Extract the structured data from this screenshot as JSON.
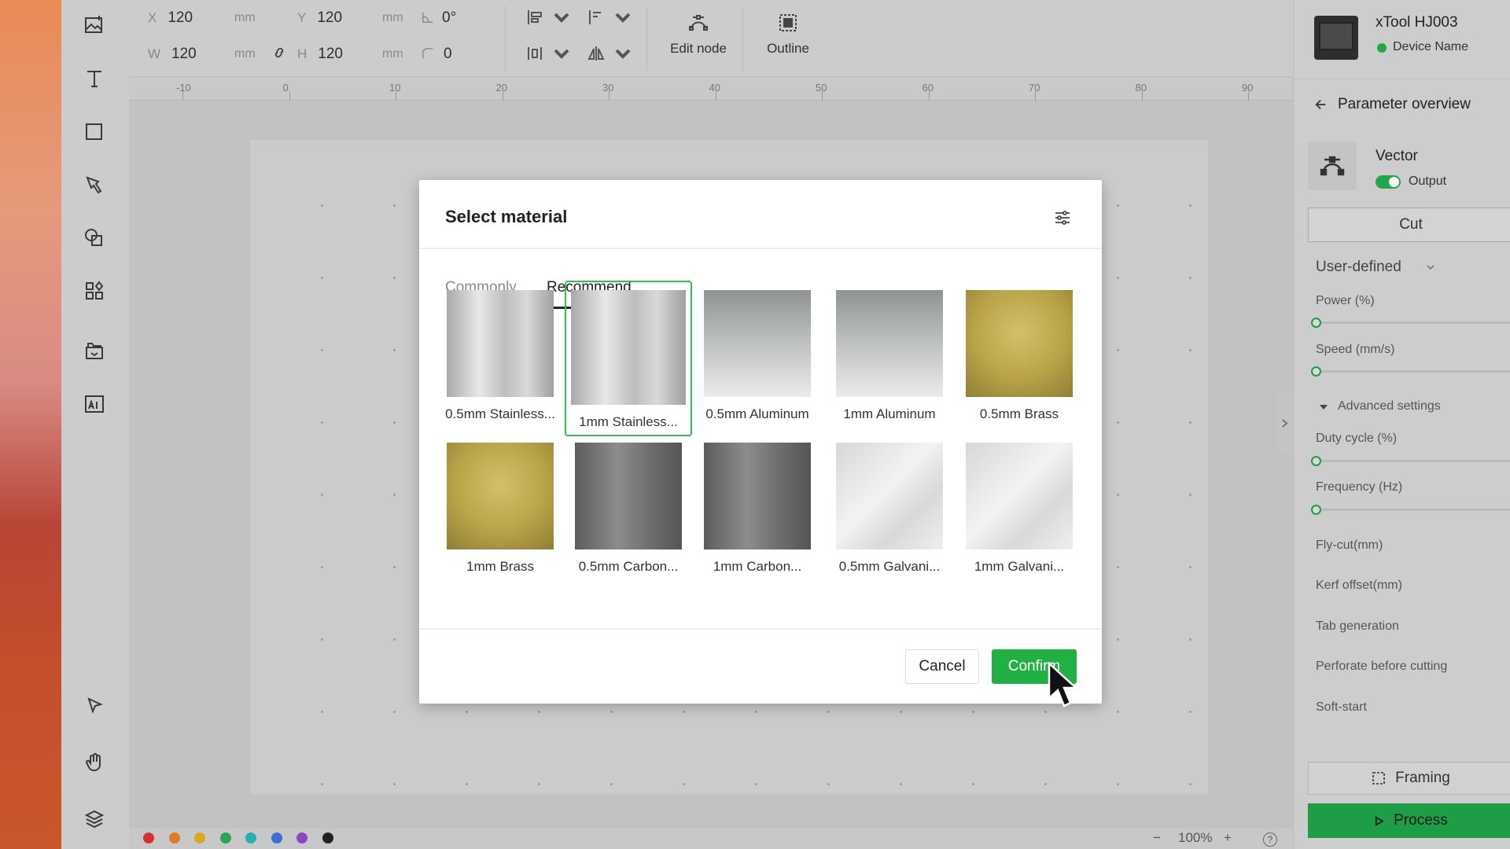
{
  "toolbar": {
    "tools": [
      "image-icon",
      "text-icon",
      "rectangle-icon",
      "pen-icon",
      "shapes-icon",
      "elements-icon",
      "project-icon",
      "ai-icon",
      "select-icon",
      "hand-icon",
      "layers-icon"
    ]
  },
  "propbar": {
    "x_label": "X",
    "x_value": "120",
    "x_unit": "mm",
    "y_label": "Y",
    "y_value": "120",
    "y_unit": "mm",
    "rotation_value": "0°",
    "w_label": "W",
    "w_value": "120",
    "w_unit": "mm",
    "h_label": "H",
    "h_value": "120",
    "h_unit": "mm",
    "corner_value": "0",
    "edit_node_label": "Edit node",
    "outline_label": "Outline"
  },
  "ruler": {
    "ticks": [
      "-10",
      "0",
      "10",
      "20",
      "30",
      "40",
      "50",
      "60",
      "70",
      "80",
      "90"
    ]
  },
  "bottombar": {
    "colors": [
      "#d8312c",
      "#e07b2a",
      "#d9a81f",
      "#2aa556",
      "#27b0b0",
      "#3a6fd8",
      "#8c45c7",
      "#222222"
    ],
    "zoom_minus": "−",
    "zoom_value": "100%",
    "zoom_plus": "+",
    "help": "?"
  },
  "rightpanel": {
    "device_name": "xTool HJ003",
    "device_status": "Device Name",
    "parameter_overview": "Parameter overview",
    "layer_type": "Vector",
    "output_label": "Output",
    "mode_button": "Cut",
    "preset": "User-defined",
    "power_label": "Power (%)",
    "speed_label": "Speed (mm/s)",
    "advanced_label": "Advanced settings",
    "duty_label": "Duty cycle (%)",
    "frequency_label": "Frequency (Hz)",
    "flycut_label": "Fly-cut(mm)",
    "kerf_label": "Kerf offset(mm)",
    "tab_label": "Tab generation",
    "perforate_label": "Perforate before cutting",
    "softstart_label": "Soft-start",
    "framing_label": "Framing",
    "process_label": "Process"
  },
  "dialog": {
    "title": "Select material",
    "tabs": [
      "Commonly",
      "Recommend"
    ],
    "active_tab": "Recommend",
    "materials": [
      {
        "name": "0.5mm Stainless...",
        "tone": "steel"
      },
      {
        "name": "1mm Stainless...",
        "tone": "steel",
        "selected": true
      },
      {
        "name": "0.5mm Aluminum",
        "tone": "alu"
      },
      {
        "name": "1mm Aluminum",
        "tone": "alu"
      },
      {
        "name": "0.5mm Brass",
        "tone": "brass"
      },
      {
        "name": "1mm Brass",
        "tone": "brass"
      },
      {
        "name": "0.5mm Carbon...",
        "tone": "carbon"
      },
      {
        "name": "1mm Carbon...",
        "tone": "carbon"
      },
      {
        "name": "0.5mm Galvani...",
        "tone": "galv"
      },
      {
        "name": "1mm Galvani...",
        "tone": "galv"
      }
    ],
    "cancel_label": "Cancel",
    "confirm_label": "Confirm"
  }
}
